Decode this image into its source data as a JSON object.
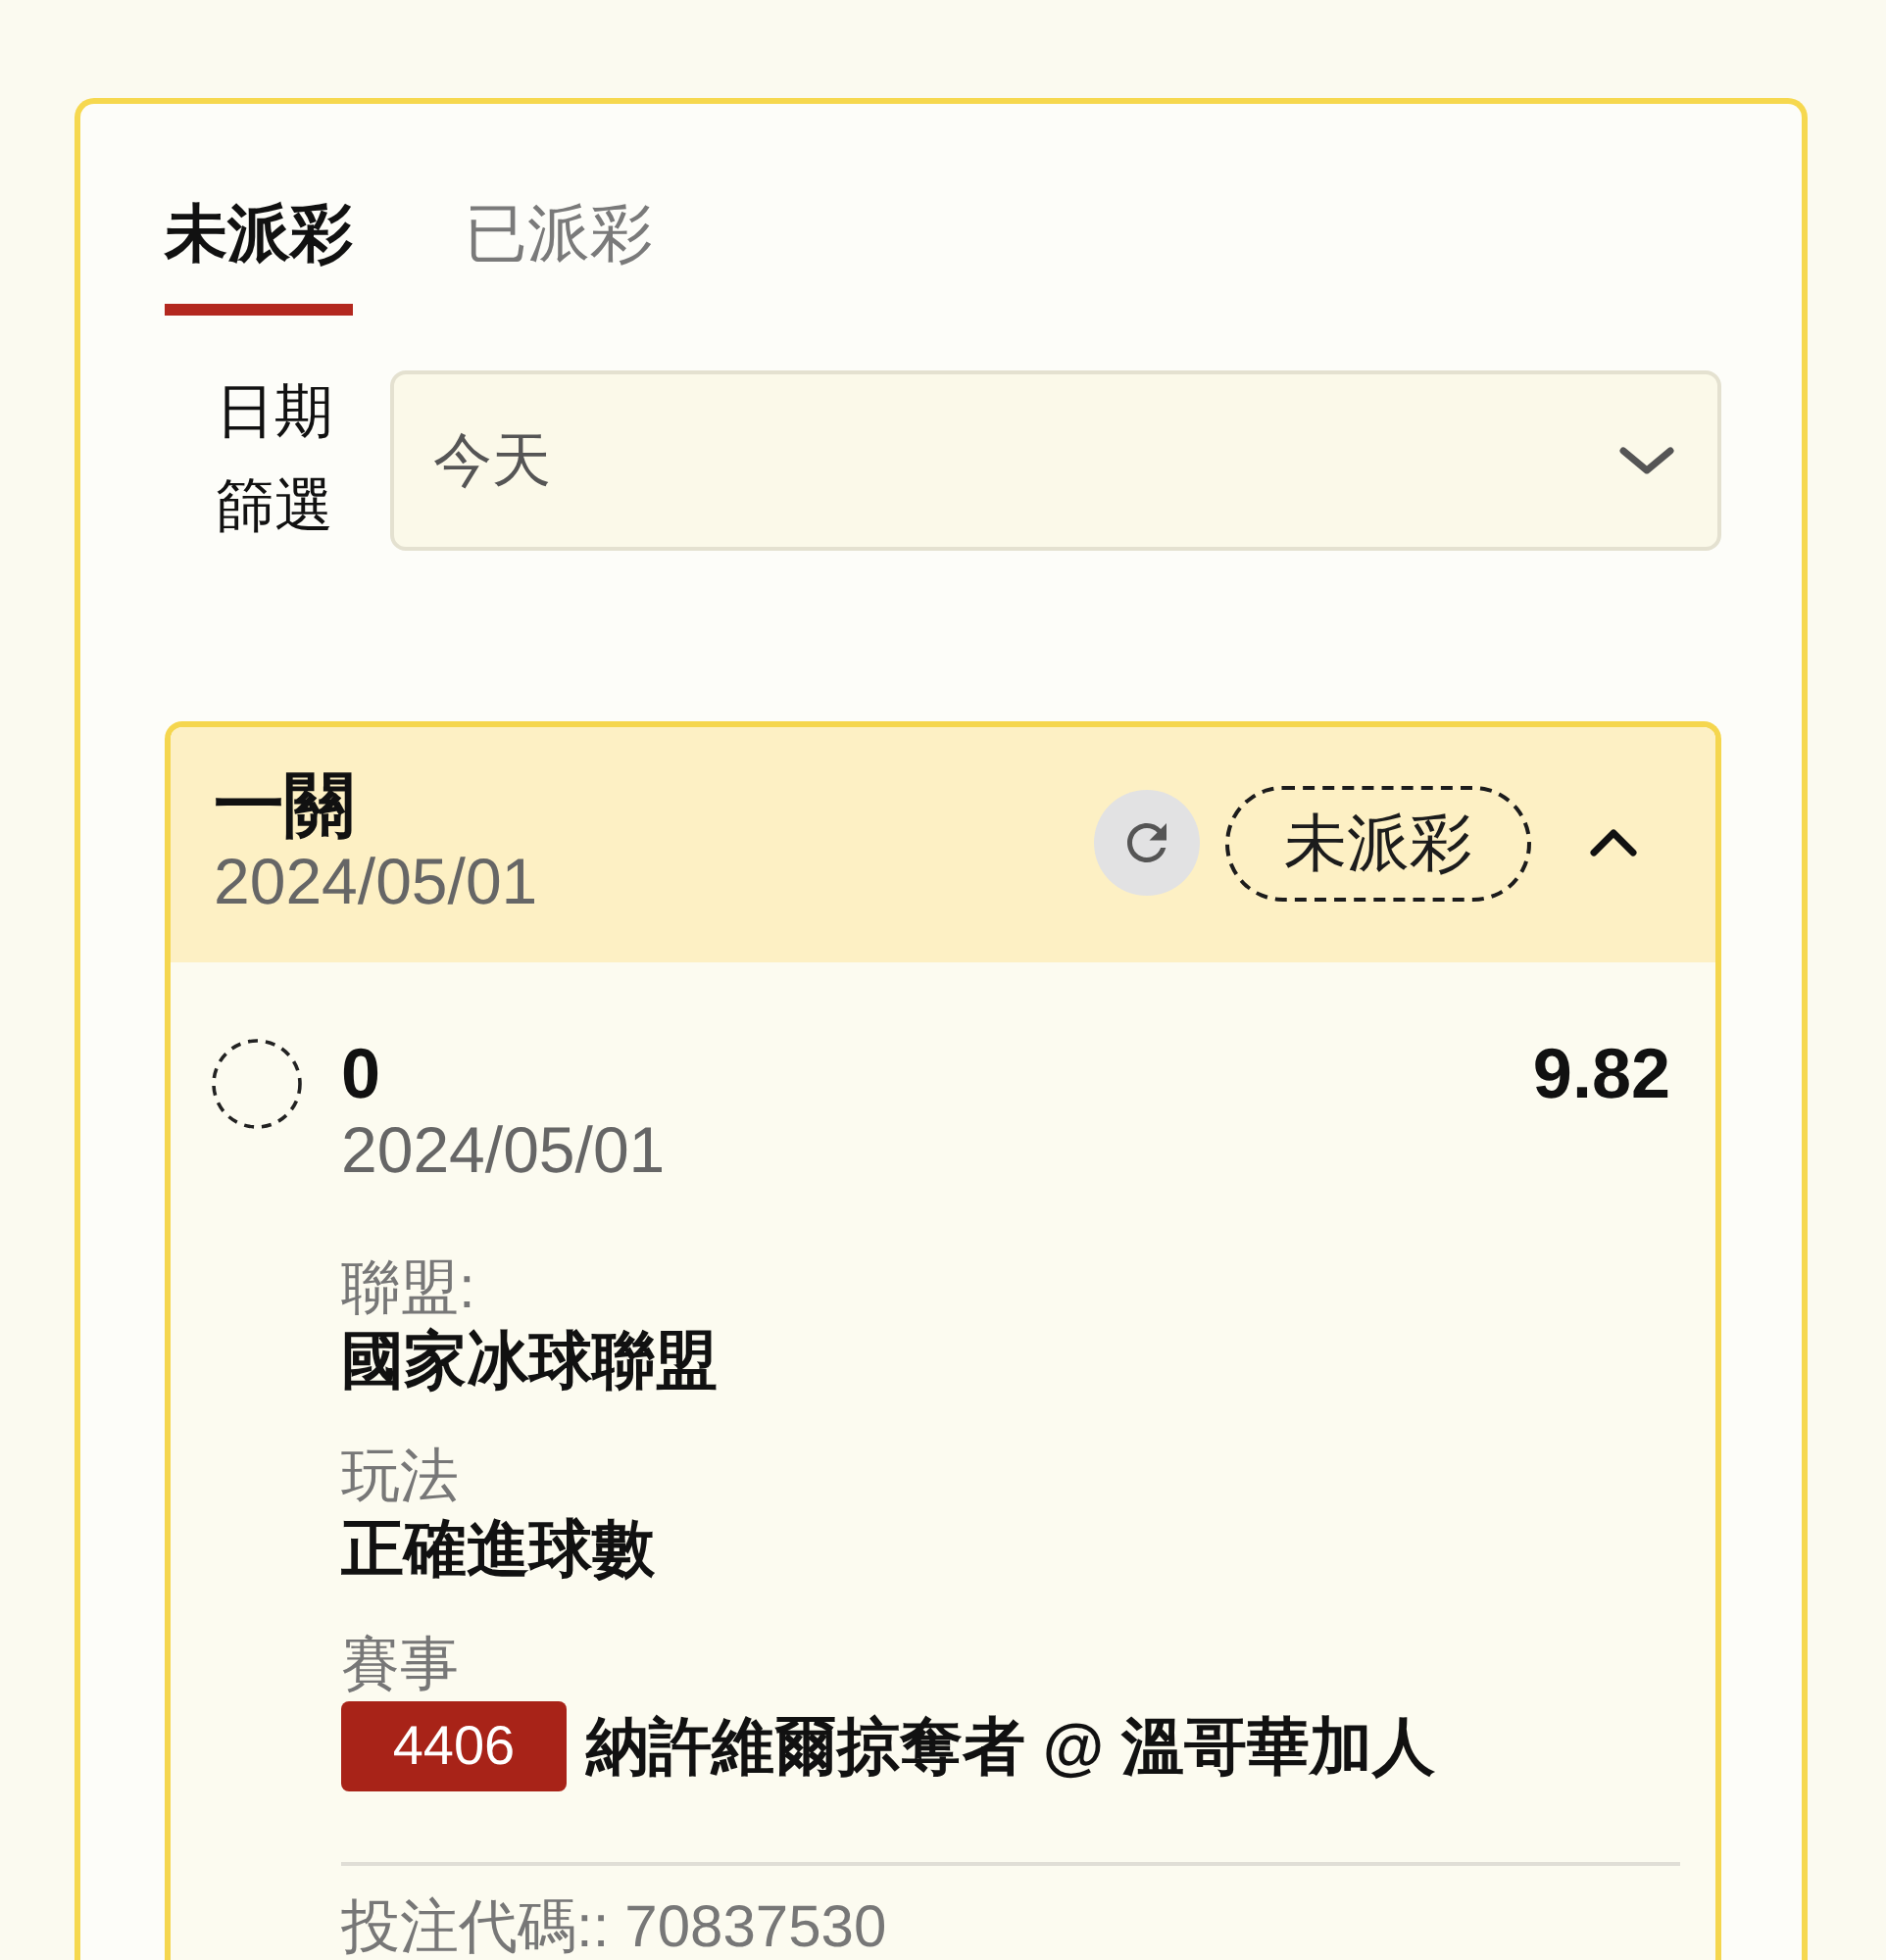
{
  "tabs": [
    {
      "label": "未派彩",
      "selected": true
    },
    {
      "label": "已派彩",
      "selected": false
    }
  ],
  "date_filter": {
    "label": "日期篩選",
    "value": "今天"
  },
  "bet": {
    "title": "一關",
    "date": "2024/05/01",
    "status": "未派彩",
    "expanded": true,
    "legs": [
      {
        "selection": "0",
        "odds": "9.82",
        "date": "2024/05/01",
        "settled": false,
        "fields": [
          {
            "label": "聯盟:",
            "value": "國家冰球聯盟"
          },
          {
            "label": "玩法",
            "value": "正確進球數"
          },
          {
            "label": "賽事",
            "match_number": "4406",
            "value": "納許維爾掠奪者 @ 溫哥華加人"
          }
        ]
      }
    ],
    "bet_code_label": "投注代碼::",
    "bet_code": "70837530"
  }
}
